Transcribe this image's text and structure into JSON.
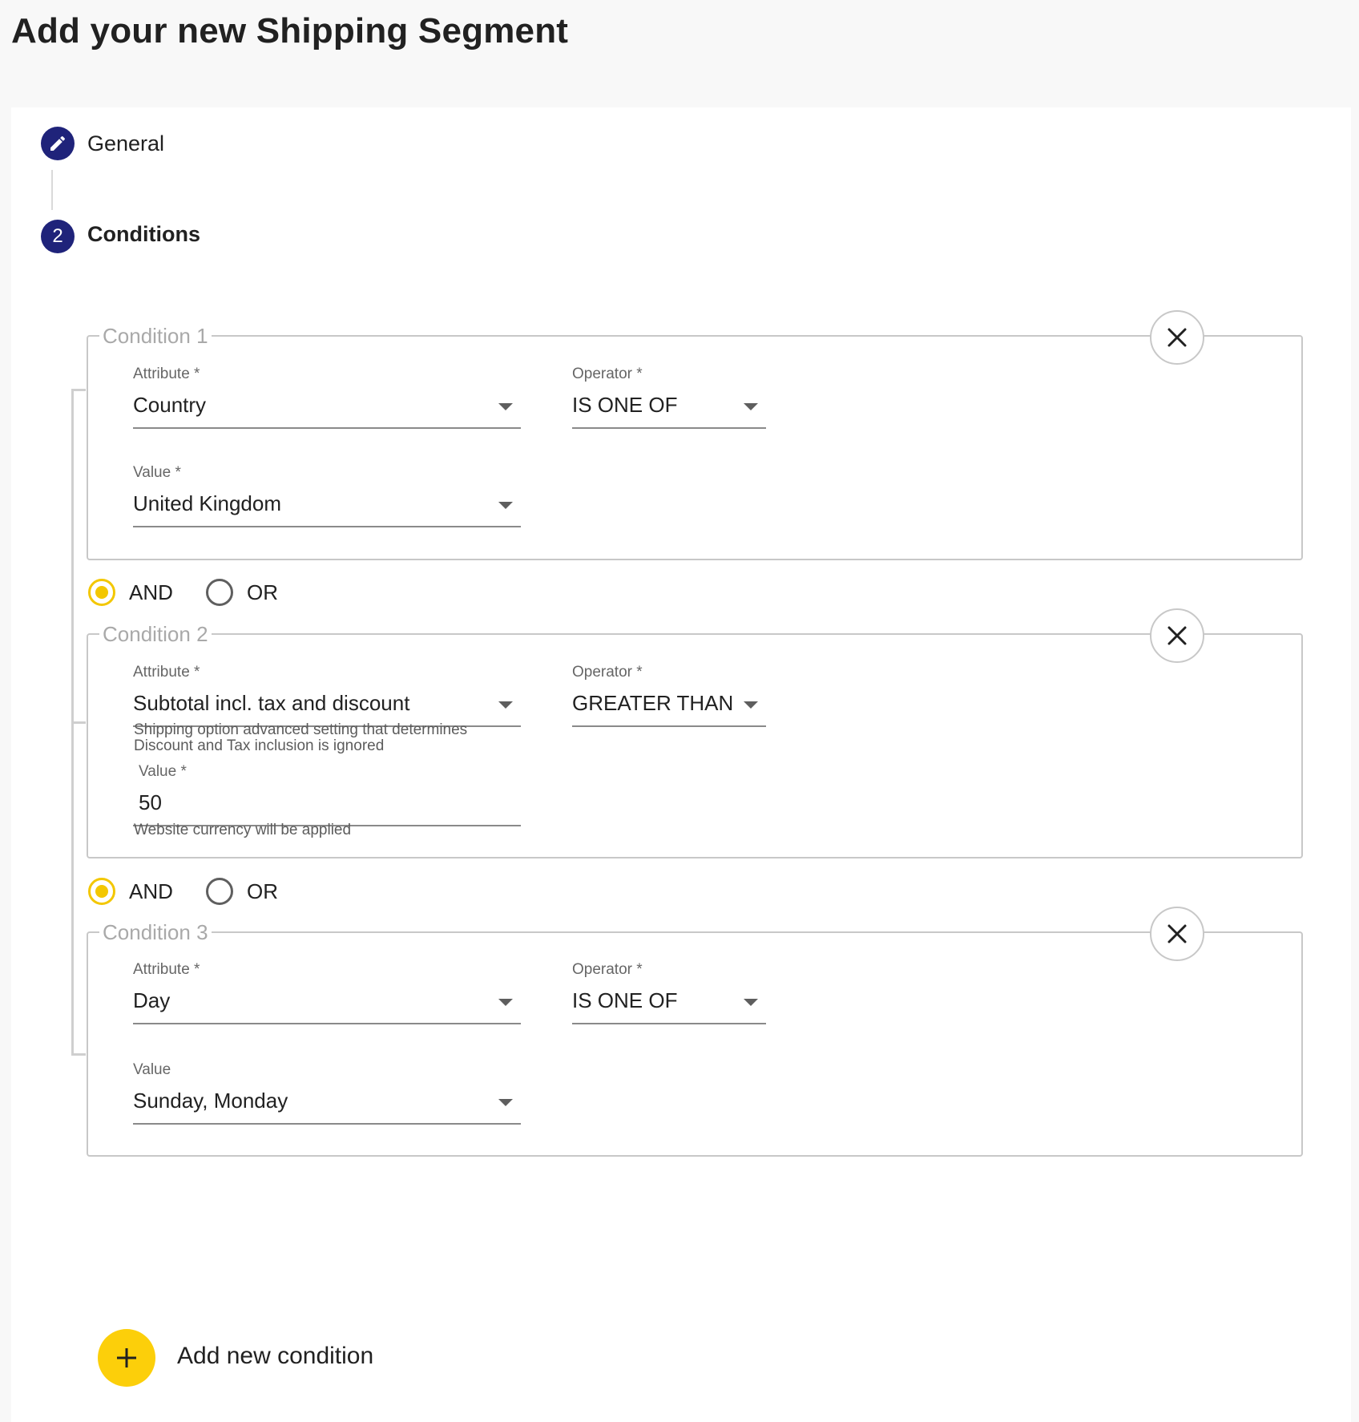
{
  "page": {
    "title": "Add your new Shipping Segment"
  },
  "stepper": {
    "steps": [
      {
        "number": "",
        "label": "General",
        "icon": "pencil-icon",
        "state": "edit"
      },
      {
        "number": "2",
        "label": "Conditions",
        "state": "active"
      }
    ]
  },
  "colors": {
    "step_circle": "#1f237a",
    "accent_yellow": "#fccf0a",
    "radio_checked": "#f3c700"
  },
  "conditions": [
    {
      "legend": "Condition 1",
      "attribute": {
        "label": "Attribute *",
        "value": "Country"
      },
      "operator": {
        "label": "Operator *",
        "value": "IS ONE OF"
      },
      "value": {
        "label": "Value *",
        "value": "United Kingdom"
      }
    },
    {
      "legend": "Condition 2",
      "attribute": {
        "label": "Attribute *",
        "value": "Subtotal incl. tax and discount",
        "hint": "Shipping option advanced setting that determines Discount and Tax inclusion is ignored"
      },
      "operator": {
        "label": "Operator *",
        "value": "GREATER THAN"
      },
      "value": {
        "label": "Value *",
        "value": "50",
        "hint": "Website currency will be applied"
      }
    },
    {
      "legend": "Condition 3",
      "attribute": {
        "label": "Attribute *",
        "value": "Day"
      },
      "operator": {
        "label": "Operator *",
        "value": "IS ONE OF"
      },
      "value": {
        "label": "Value",
        "value": "Sunday, Monday"
      }
    }
  ],
  "logic": [
    {
      "and_label": "AND",
      "or_label": "OR",
      "selected": "AND"
    },
    {
      "and_label": "AND",
      "or_label": "OR",
      "selected": "AND"
    }
  ],
  "actions": {
    "add_condition_label": "Add new condition"
  }
}
